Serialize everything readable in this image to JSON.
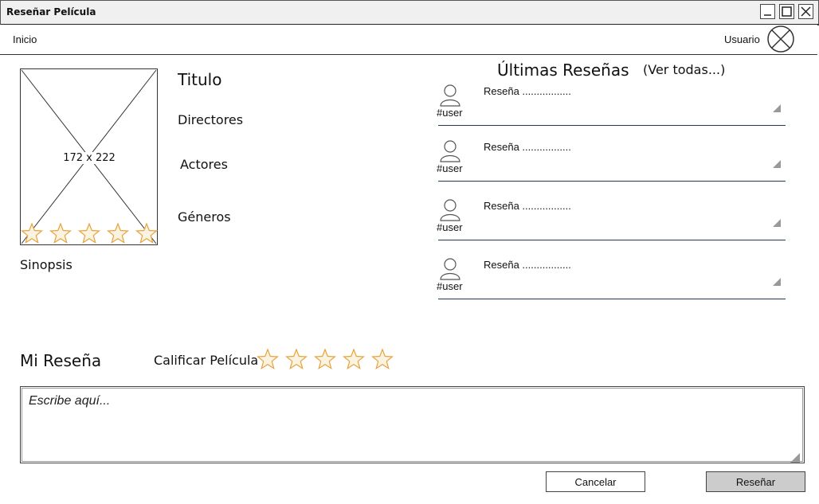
{
  "window": {
    "title": "Reseñar Película"
  },
  "menu": {
    "home": "Inicio",
    "user": "Usuario"
  },
  "movie": {
    "poster_size": "172 x 222",
    "title_label": "Titulo",
    "directors_label": "Directores",
    "actors_label": "Actores",
    "genres_label": "Géneros",
    "synopsis_label": "Sinopsis",
    "rating_stars": 5
  },
  "latest_reviews": {
    "heading": "Últimas Reseñas",
    "see_all": "(Ver todas...)",
    "items": [
      {
        "user": "#user",
        "text": "Reseña ................."
      },
      {
        "user": "#user",
        "text": "Reseña ................."
      },
      {
        "user": "#user",
        "text": "Reseña ................."
      },
      {
        "user": "#user",
        "text": "Reseña ................."
      }
    ]
  },
  "my_review": {
    "heading": "Mi Reseña",
    "rate_label": "Calificar Película",
    "placeholder": "Escribe aquí...",
    "cancel": "Cancelar",
    "submit": "Reseñar"
  },
  "colors": {
    "star_fill": "#fbf3e2",
    "star_stroke": "#e8a33a",
    "underline": "#1f3760",
    "submit_bg": "#cccccc"
  }
}
